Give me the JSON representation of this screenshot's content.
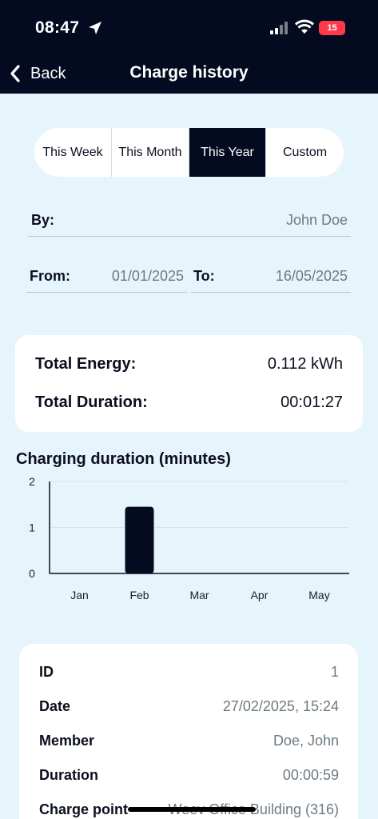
{
  "status_bar": {
    "time": "08:47",
    "battery": "15"
  },
  "nav": {
    "back_label": "Back",
    "title": "Charge history"
  },
  "period_tabs": [
    {
      "label": "This Week",
      "active": false
    },
    {
      "label": "This Month",
      "active": false
    },
    {
      "label": "This Year",
      "active": true
    },
    {
      "label": "Custom",
      "active": false
    }
  ],
  "filters": {
    "by_label": "By:",
    "by_value": "John Doe",
    "from_label": "From:",
    "from_value": "01/01/2025",
    "to_label": "To:",
    "to_value": "16/05/2025"
  },
  "summary": {
    "energy_label": "Total Energy:",
    "energy_value": "0.112 kWh",
    "duration_label": "Total Duration:",
    "duration_value": "00:01:27"
  },
  "chart_data": {
    "type": "bar",
    "title": "Charging duration (minutes)",
    "categories": [
      "Jan",
      "Feb",
      "Mar",
      "Apr",
      "May"
    ],
    "values": [
      0,
      1.45,
      0,
      0,
      0
    ],
    "ylim": [
      0,
      2
    ],
    "yticks": [
      0,
      1,
      2
    ],
    "xlabel": "",
    "ylabel": "",
    "grid": true,
    "bar_color": "#040b20"
  },
  "session": {
    "rows": [
      {
        "label": "ID",
        "value": "1"
      },
      {
        "label": "Date",
        "value": "27/02/2025, 15:24"
      },
      {
        "label": "Member",
        "value": "Doe, John"
      },
      {
        "label": "Duration",
        "value": "00:00:59"
      },
      {
        "label": "Charge point",
        "value": "Weev Office Building (316)"
      }
    ]
  }
}
